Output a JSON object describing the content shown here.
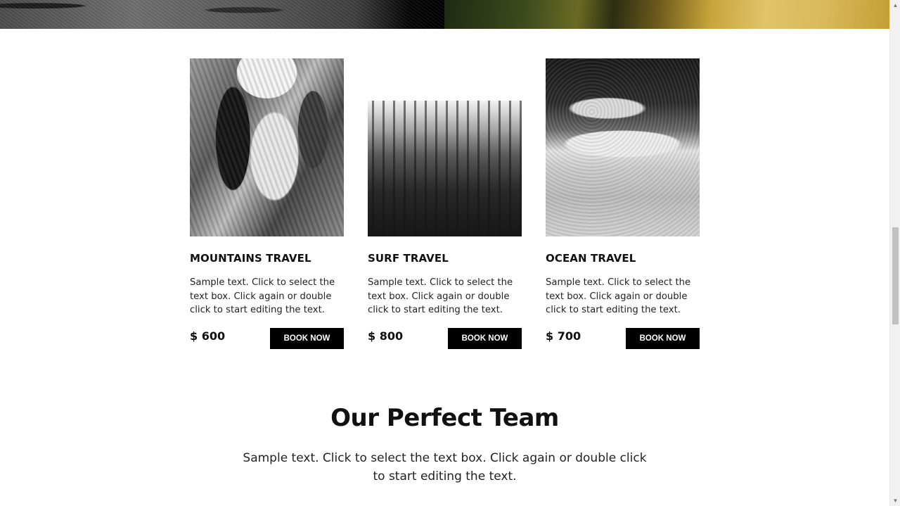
{
  "cards": [
    {
      "title": "MOUNTAINS TRAVEL",
      "text": "Sample text. Click to select the text box. Click again or double click to start editing the text.",
      "price": "$ 600",
      "button": "BOOK NOW",
      "image": "canyon-photo"
    },
    {
      "title": "SURF TRAVEL",
      "text": "Sample text. Click to select the text box. Click again or double click to start editing the text.",
      "price": "$ 800",
      "button": "BOOK NOW",
      "image": "forest-photo"
    },
    {
      "title": "OCEAN TRAVEL",
      "text": "Sample text. Click to select the text box. Click again or double click to start editing the text.",
      "price": "$ 700",
      "button": "BOOK NOW",
      "image": "ocean-photo"
    }
  ],
  "team": {
    "title": "Our Perfect Team",
    "text": "Sample text. Click to select the text box. Click again or double click to start editing the text."
  },
  "scrollbar": {
    "up_arrow": "▲",
    "down_arrow": "▼"
  },
  "colors": {
    "button_bg": "#000000",
    "button_text": "#ffffff",
    "heading": "#111111"
  }
}
